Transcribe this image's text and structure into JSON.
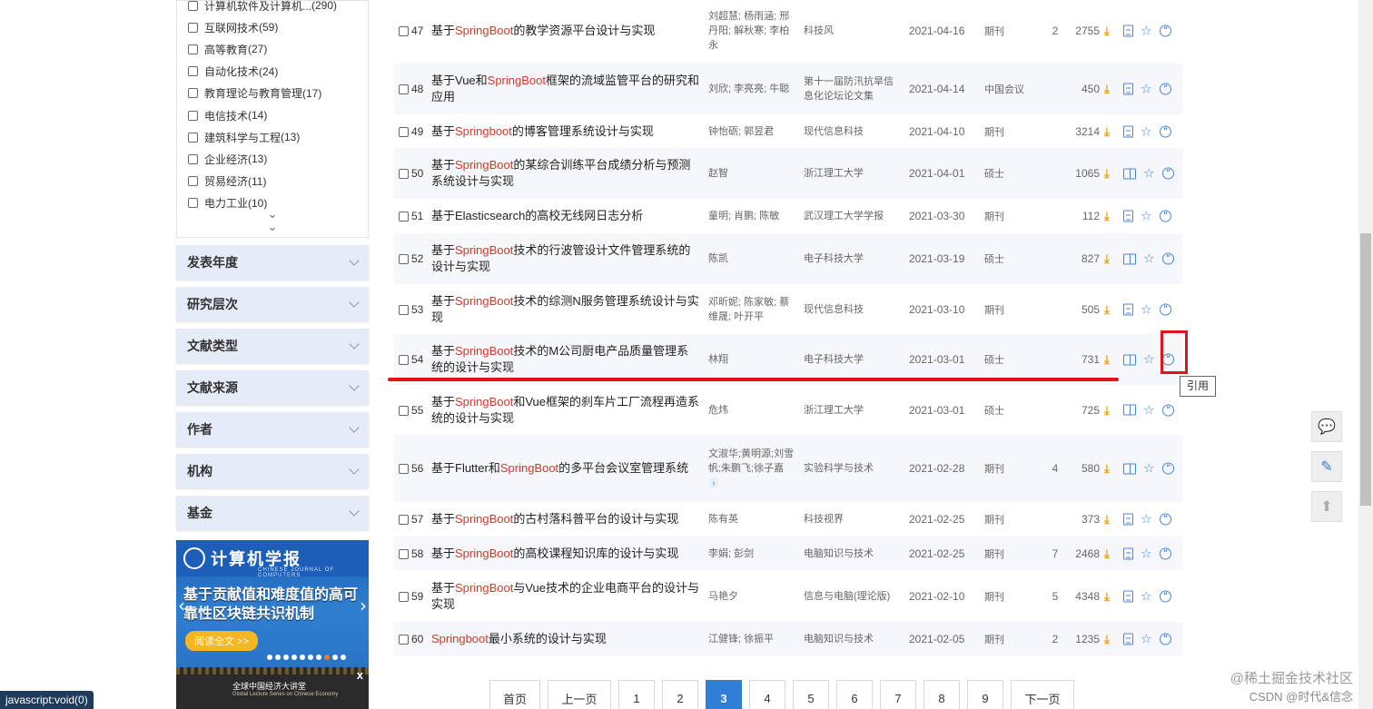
{
  "sidebar": {
    "filters": [
      {
        "label": "计算机软件及计算机...",
        "count": "(290)"
      },
      {
        "label": "互联网技术",
        "count": "(59)"
      },
      {
        "label": "高等教育",
        "count": "(27)"
      },
      {
        "label": "自动化技术",
        "count": "(24)"
      },
      {
        "label": "教育理论与教育管理",
        "count": "(17)"
      },
      {
        "label": "电信技术",
        "count": "(14)"
      },
      {
        "label": "建筑科学与工程",
        "count": "(13)"
      },
      {
        "label": "企业经济",
        "count": "(13)"
      },
      {
        "label": "贸易经济",
        "count": "(11)"
      },
      {
        "label": "电力工业",
        "count": "(10)"
      }
    ],
    "more_icon": "double-chevron-down-icon",
    "sections": [
      "发表年度",
      "研究层次",
      "文献类型",
      "文献来源",
      "作者",
      "机构",
      "基金"
    ],
    "banner": {
      "journal_name": "计算机学报",
      "journal_subtitle": "CHINESE JOURNAL OF COMPUTERS",
      "headline": "基于贡献值和难度值的高可靠性区块链共识机制",
      "read_button": "阅读全文 >>"
    },
    "banner2": {
      "title": "全球中国经济大讲堂",
      "subtitle": "Global Lecture Series on Chinese Economy",
      "close": "x"
    }
  },
  "results": [
    {
      "num": "47",
      "title": [
        [
          "基于",
          0
        ],
        [
          "SpringBoot",
          1
        ],
        [
          "的教学资源平台设计与实现",
          0
        ]
      ],
      "authors": "刘超慧; 杨雨涵; 邢丹阳; 解秋寒; 李柏永",
      "source": "科技风",
      "date": "2021-04-16",
      "type": "期刊",
      "cited": "2",
      "downloads": "2755",
      "html": true
    },
    {
      "num": "48",
      "title": [
        [
          "基于Vue和",
          0
        ],
        [
          "SpringBoot",
          1
        ],
        [
          "框架的流域监管平台的研究和应用",
          0
        ]
      ],
      "authors": "刘欣; 李亮亮; 牛聪",
      "source": "第十一届防汛抗旱信息化论坛论文集",
      "date": "2021-04-14",
      "type": "中国会议",
      "cited": "",
      "downloads": "450",
      "html": true
    },
    {
      "num": "49",
      "title": [
        [
          "基于",
          0
        ],
        [
          "Springboot",
          1
        ],
        [
          "的博客管理系统设计与实现",
          0
        ]
      ],
      "authors": "钟怡砺; 郭昱君",
      "source": "现代信息科技",
      "date": "2021-04-10",
      "type": "期刊",
      "cited": "",
      "downloads": "3214",
      "html": true
    },
    {
      "num": "50",
      "title": [
        [
          "基于",
          0
        ],
        [
          "SpringBoot",
          1
        ],
        [
          "的某综合训练平台成绩分析与预测系统设计与实现",
          0
        ]
      ],
      "authors": "赵智",
      "source": "浙江理工大学",
      "date": "2021-04-01",
      "type": "硕士",
      "cited": "",
      "downloads": "1065",
      "html": false
    },
    {
      "num": "51",
      "title": [
        [
          "基于Elasticsearch的高校无线网日志分析",
          0
        ]
      ],
      "authors": "童明; 肖鹏; 陈敏",
      "source": "武汉理工大学学报",
      "date": "2021-03-30",
      "type": "期刊",
      "cited": "",
      "downloads": "112",
      "html": true
    },
    {
      "num": "52",
      "title": [
        [
          "基于",
          0
        ],
        [
          "SpringBoot",
          1
        ],
        [
          "技术的行波管设计文件管理系统的设计与实现",
          0
        ]
      ],
      "authors": "陈凯",
      "source": "电子科技大学",
      "date": "2021-03-19",
      "type": "硕士",
      "cited": "",
      "downloads": "827",
      "html": false
    },
    {
      "num": "53",
      "title": [
        [
          "基于",
          0
        ],
        [
          "SpringBoot",
          1
        ],
        [
          "技术的综测N服务管理系统设计与实现",
          0
        ]
      ],
      "authors": "邓昕妮; 陈家敏; 蔡维晟; 叶开平",
      "source": "现代信息科技",
      "date": "2021-03-10",
      "type": "期刊",
      "cited": "",
      "downloads": "505",
      "html": true
    },
    {
      "num": "54",
      "title": [
        [
          "基于",
          0
        ],
        [
          "SpringBoot",
          1
        ],
        [
          "技术的M公司厨电产品质量管理系统的设计与实现",
          0
        ]
      ],
      "authors": "林翔",
      "source": "电子科技大学",
      "date": "2021-03-01",
      "type": "硕士",
      "cited": "",
      "downloads": "731",
      "html": false
    },
    {
      "num": "55",
      "title": [
        [
          "基于",
          0
        ],
        [
          "SpringBoot",
          1
        ],
        [
          "和Vue框架的刹车片工厂流程再造系统的设计与实现",
          0
        ]
      ],
      "authors": "危炜",
      "source": "浙江理工大学",
      "date": "2021-03-01",
      "type": "硕士",
      "cited": "",
      "downloads": "725",
      "html": false
    },
    {
      "num": "56",
      "title": [
        [
          "基于Flutter和",
          0
        ],
        [
          "SpringBoot",
          1
        ],
        [
          "的多平台会议室管理系统",
          0
        ]
      ],
      "authors": "文淑华;黄明源;刘雪帆;朱鹏飞;徐子嘉",
      "source": "实验科学与技术",
      "date": "2021-02-28",
      "type": "期刊",
      "cited": "4",
      "downloads": "580",
      "html": false,
      "expand_author": true
    },
    {
      "num": "57",
      "title": [
        [
          "基于",
          0
        ],
        [
          "SpringBoot",
          1
        ],
        [
          "的古村落科普平台的设计与实现",
          0
        ]
      ],
      "authors": "陈有英",
      "source": "科技视界",
      "date": "2021-02-25",
      "type": "期刊",
      "cited": "",
      "downloads": "373",
      "html": true
    },
    {
      "num": "58",
      "title": [
        [
          "基于",
          0
        ],
        [
          "SpringBoot",
          1
        ],
        [
          "的高校课程知识库的设计与实现",
          0
        ]
      ],
      "authors": "李娟; 彭剑",
      "source": "电脑知识与技术",
      "date": "2021-02-25",
      "type": "期刊",
      "cited": "7",
      "downloads": "2468",
      "html": true
    },
    {
      "num": "59",
      "title": [
        [
          "基于",
          0
        ],
        [
          "SpringBoot",
          1
        ],
        [
          "与Vue技术的企业电商平台的设计与实现",
          0
        ]
      ],
      "authors": "马艳夕",
      "source": "信息与电脑(理论版)",
      "date": "2021-02-10",
      "type": "期刊",
      "cited": "5",
      "downloads": "4348",
      "html": true
    },
    {
      "num": "60",
      "title": [
        [
          "Springboot",
          1
        ],
        [
          "最小系统的设计与实现",
          0
        ]
      ],
      "authors": "江健锋; 徐振平",
      "source": "电脑知识与技术",
      "date": "2021-02-05",
      "type": "期刊",
      "cited": "2",
      "downloads": "1235",
      "html": true
    }
  ],
  "tooltip": "引用",
  "pagination": {
    "first": "首页",
    "prev": "上一页",
    "pages": [
      "1",
      "2",
      "3",
      "4",
      "5",
      "6",
      "7",
      "8",
      "9"
    ],
    "current": "3",
    "next": "下一页"
  },
  "status_bar": "javascript:void(0)",
  "watermark": {
    "line1": "@稀土掘金技术社区",
    "line2": "CSDN @时代&信念"
  },
  "colors": {
    "keyword": "#d13a2a",
    "accent": "#2f7fd8",
    "annotation": "#e0141c",
    "icon_blue": "#4a86d6",
    "download_orange": "#e8a21a"
  },
  "float_tools": [
    "feedback-icon",
    "edit-icon",
    "back-to-top-icon"
  ]
}
